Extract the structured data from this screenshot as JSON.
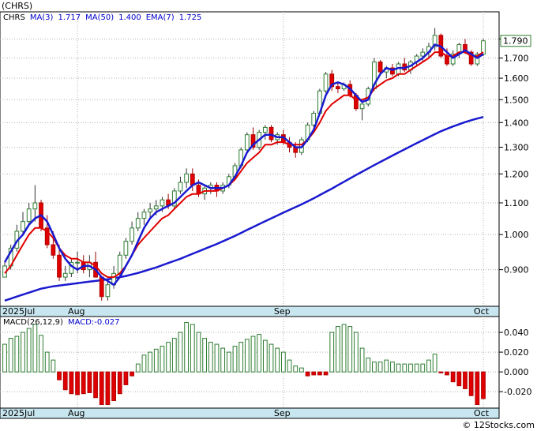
{
  "chart_data": [
    {
      "type": "candlestick",
      "title": "(CHRS)",
      "legend": [
        {
          "text": "CHRS",
          "color": "#000000"
        },
        {
          "text": "MA(3)",
          "color": "#0000cc"
        },
        {
          "text": "1.717",
          "color": "#0000cc"
        },
        {
          "text": "MA(50)",
          "color": "#0000cc"
        },
        {
          "text": "1.400",
          "color": "#0000cc"
        },
        {
          "text": "EMA(7)",
          "color": "#0000cc"
        },
        {
          "text": "1.725",
          "color": "#0000cc"
        }
      ],
      "y_scale": "log",
      "ylim": [
        0.81,
        1.93
      ],
      "y_ticks": [
        0.9,
        1.0,
        1.1,
        1.2,
        1.3,
        1.4,
        1.5,
        1.6,
        1.7,
        1.8
      ],
      "y_tick_labels": [
        "0.900",
        "1.000",
        "1.100",
        "1.200",
        "1.300",
        "1.400",
        "1.500",
        "1.600",
        "1.700",
        "1.800"
      ],
      "last_price_label": "1.790",
      "x_labels": [
        {
          "text": "2025Jul",
          "index": 0
        },
        {
          "text": "Aug",
          "index": 12
        },
        {
          "text": "Sep",
          "index": 46
        },
        {
          "text": "Oct",
          "index": 79
        }
      ],
      "grid": true,
      "ohlc": [
        [
          0.88,
          0.92,
          0.88,
          0.91
        ],
        [
          0.91,
          0.97,
          0.9,
          0.96
        ],
        [
          0.96,
          1.03,
          0.95,
          1.01
        ],
        [
          1.01,
          1.07,
          1.0,
          1.04
        ],
        [
          1.04,
          1.1,
          1.03,
          1.08
        ],
        [
          1.08,
          1.16,
          1.04,
          1.1
        ],
        [
          1.1,
          1.11,
          1.01,
          1.02
        ],
        [
          1.02,
          1.06,
          0.96,
          0.97
        ],
        [
          0.97,
          1.01,
          0.93,
          0.94
        ],
        [
          0.94,
          0.97,
          0.87,
          0.88
        ],
        [
          0.88,
          0.91,
          0.87,
          0.89
        ],
        [
          0.89,
          0.93,
          0.88,
          0.92
        ],
        [
          0.92,
          0.95,
          0.89,
          0.92
        ],
        [
          0.92,
          0.94,
          0.89,
          0.9
        ],
        [
          0.9,
          0.94,
          0.88,
          0.92
        ],
        [
          0.92,
          0.95,
          0.9,
          0.88
        ],
        [
          0.88,
          0.88,
          0.82,
          0.83
        ],
        [
          0.83,
          0.87,
          0.82,
          0.86
        ],
        [
          0.86,
          0.91,
          0.85,
          0.89
        ],
        [
          0.89,
          0.95,
          0.88,
          0.94
        ],
        [
          0.94,
          0.99,
          0.93,
          0.98
        ],
        [
          0.98,
          1.04,
          0.97,
          1.02
        ],
        [
          1.02,
          1.07,
          1.01,
          1.05
        ],
        [
          1.05,
          1.08,
          1.03,
          1.07
        ],
        [
          1.07,
          1.1,
          1.05,
          1.08
        ],
        [
          1.08,
          1.11,
          1.06,
          1.09
        ],
        [
          1.09,
          1.12,
          1.07,
          1.11
        ],
        [
          1.11,
          1.13,
          1.08,
          1.09
        ],
        [
          1.09,
          1.15,
          1.08,
          1.14
        ],
        [
          1.14,
          1.19,
          1.13,
          1.17
        ],
        [
          1.17,
          1.22,
          1.15,
          1.2
        ],
        [
          1.2,
          1.22,
          1.14,
          1.16
        ],
        [
          1.16,
          1.18,
          1.12,
          1.13
        ],
        [
          1.13,
          1.16,
          1.11,
          1.15
        ],
        [
          1.15,
          1.17,
          1.13,
          1.16
        ],
        [
          1.16,
          1.17,
          1.12,
          1.14
        ],
        [
          1.14,
          1.17,
          1.13,
          1.16
        ],
        [
          1.16,
          1.2,
          1.15,
          1.19
        ],
        [
          1.19,
          1.24,
          1.18,
          1.23
        ],
        [
          1.23,
          1.3,
          1.22,
          1.29
        ],
        [
          1.29,
          1.36,
          1.28,
          1.35
        ],
        [
          1.35,
          1.38,
          1.29,
          1.3
        ],
        [
          1.3,
          1.37,
          1.29,
          1.36
        ],
        [
          1.36,
          1.39,
          1.33,
          1.38
        ],
        [
          1.38,
          1.39,
          1.32,
          1.33
        ],
        [
          1.33,
          1.36,
          1.31,
          1.35
        ],
        [
          1.35,
          1.37,
          1.31,
          1.32
        ],
        [
          1.32,
          1.34,
          1.28,
          1.3
        ],
        [
          1.3,
          1.32,
          1.26,
          1.28
        ],
        [
          1.28,
          1.34,
          1.27,
          1.33
        ],
        [
          1.33,
          1.4,
          1.32,
          1.39
        ],
        [
          1.39,
          1.45,
          1.38,
          1.44
        ],
        [
          1.44,
          1.55,
          1.43,
          1.54
        ],
        [
          1.54,
          1.63,
          1.53,
          1.62
        ],
        [
          1.62,
          1.64,
          1.54,
          1.56
        ],
        [
          1.56,
          1.58,
          1.53,
          1.55
        ],
        [
          1.55,
          1.58,
          1.54,
          1.57
        ],
        [
          1.57,
          1.59,
          1.51,
          1.52
        ],
        [
          1.52,
          1.53,
          1.45,
          1.46
        ],
        [
          1.46,
          1.5,
          1.41,
          1.48
        ],
        [
          1.48,
          1.56,
          1.47,
          1.55
        ],
        [
          1.55,
          1.7,
          1.54,
          1.68
        ],
        [
          1.68,
          1.69,
          1.62,
          1.63
        ],
        [
          1.63,
          1.66,
          1.6,
          1.65
        ],
        [
          1.65,
          1.67,
          1.61,
          1.62
        ],
        [
          1.62,
          1.68,
          1.61,
          1.67
        ],
        [
          1.67,
          1.7,
          1.63,
          1.64
        ],
        [
          1.64,
          1.69,
          1.62,
          1.68
        ],
        [
          1.68,
          1.72,
          1.66,
          1.71
        ],
        [
          1.71,
          1.75,
          1.68,
          1.73
        ],
        [
          1.73,
          1.78,
          1.7,
          1.76
        ],
        [
          1.76,
          1.86,
          1.74,
          1.82
        ],
        [
          1.82,
          1.83,
          1.7,
          1.71
        ],
        [
          1.71,
          1.75,
          1.66,
          1.67
        ],
        [
          1.67,
          1.74,
          1.66,
          1.72
        ],
        [
          1.72,
          1.78,
          1.7,
          1.77
        ],
        [
          1.77,
          1.8,
          1.72,
          1.73
        ],
        [
          1.73,
          1.74,
          1.66,
          1.67
        ],
        [
          1.67,
          1.73,
          1.66,
          1.72
        ],
        [
          1.72,
          1.8,
          1.71,
          1.79
        ]
      ],
      "ma3": [
        0.92,
        0.95,
        0.98,
        1.0,
        1.03,
        1.05,
        1.06,
        1.04,
        1.0,
        0.96,
        0.93,
        0.91,
        0.9,
        0.91,
        0.91,
        0.9,
        0.88,
        0.87,
        0.86,
        0.88,
        0.91,
        0.94,
        0.98,
        1.02,
        1.05,
        1.07,
        1.08,
        1.09,
        1.1,
        1.12,
        1.14,
        1.16,
        1.17,
        1.16,
        1.15,
        1.15,
        1.15,
        1.16,
        1.19,
        1.23,
        1.28,
        1.31,
        1.33,
        1.35,
        1.35,
        1.34,
        1.34,
        1.32,
        1.3,
        1.3,
        1.33,
        1.37,
        1.44,
        1.52,
        1.57,
        1.58,
        1.57,
        1.55,
        1.52,
        1.49,
        1.5,
        1.57,
        1.62,
        1.65,
        1.64,
        1.65,
        1.65,
        1.66,
        1.68,
        1.7,
        1.73,
        1.77,
        1.76,
        1.73,
        1.7,
        1.72,
        1.74,
        1.72,
        1.7,
        1.72
      ],
      "ma50": [
        0.82,
        0.825,
        0.83,
        0.835,
        0.84,
        0.845,
        0.85,
        0.853,
        0.856,
        0.858,
        0.86,
        0.862,
        0.864,
        0.866,
        0.868,
        0.87,
        0.872,
        0.874,
        0.877,
        0.88,
        0.883,
        0.887,
        0.891,
        0.896,
        0.901,
        0.906,
        0.912,
        0.918,
        0.924,
        0.93,
        0.937,
        0.944,
        0.951,
        0.958,
        0.965,
        0.972,
        0.98,
        0.988,
        0.996,
        1.005,
        1.014,
        1.023,
        1.032,
        1.041,
        1.05,
        1.059,
        1.068,
        1.077,
        1.086,
        1.095,
        1.105,
        1.115,
        1.126,
        1.137,
        1.148,
        1.16,
        1.172,
        1.184,
        1.196,
        1.208,
        1.22,
        1.232,
        1.244,
        1.256,
        1.268,
        1.28,
        1.292,
        1.304,
        1.316,
        1.328,
        1.34,
        1.352,
        1.364,
        1.374,
        1.384,
        1.393,
        1.402,
        1.41,
        1.417,
        1.424
      ],
      "ema7": [
        0.89,
        0.91,
        0.94,
        0.97,
        1.0,
        1.02,
        1.02,
        1.01,
        0.99,
        0.96,
        0.94,
        0.93,
        0.93,
        0.92,
        0.92,
        0.91,
        0.89,
        0.88,
        0.88,
        0.89,
        0.91,
        0.94,
        0.97,
        0.99,
        1.01,
        1.03,
        1.05,
        1.06,
        1.08,
        1.1,
        1.12,
        1.13,
        1.13,
        1.14,
        1.14,
        1.14,
        1.15,
        1.16,
        1.18,
        1.21,
        1.24,
        1.26,
        1.28,
        1.31,
        1.31,
        1.32,
        1.32,
        1.31,
        1.31,
        1.31,
        1.33,
        1.36,
        1.4,
        1.45,
        1.48,
        1.5,
        1.52,
        1.52,
        1.5,
        1.5,
        1.51,
        1.55,
        1.57,
        1.59,
        1.6,
        1.62,
        1.62,
        1.64,
        1.66,
        1.68,
        1.7,
        1.73,
        1.73,
        1.71,
        1.71,
        1.73,
        1.73,
        1.71,
        1.71,
        1.73
      ]
    },
    {
      "type": "bar",
      "title": "MACD(26,12,9)",
      "legend": [
        {
          "text": "MACD(26,12,9)",
          "color": "#000000"
        },
        {
          "text": "MACD:-0.027",
          "color": "#0000cc"
        }
      ],
      "ylim": [
        -0.035,
        0.052
      ],
      "y_ticks": [
        -0.02,
        0.0,
        0.02,
        0.04
      ],
      "y_tick_labels": [
        "-0.020",
        "0.000",
        "0.020",
        "0.040"
      ],
      "x_labels": [
        {
          "text": "2025Jul",
          "index": 0
        },
        {
          "text": "Aug",
          "index": 12
        },
        {
          "text": "Sep",
          "index": 46
        },
        {
          "text": "Oct",
          "index": 79
        }
      ],
      "grid": true,
      "values": [
        0.028,
        0.034,
        0.036,
        0.04,
        0.044,
        0.048,
        0.037,
        0.02,
        0.012,
        -0.008,
        -0.018,
        -0.022,
        -0.023,
        -0.022,
        -0.021,
        -0.026,
        -0.033,
        -0.033,
        -0.029,
        -0.022,
        -0.013,
        -0.004,
        0.008,
        0.017,
        0.02,
        0.023,
        0.026,
        0.03,
        0.034,
        0.04,
        0.05,
        0.048,
        0.04,
        0.034,
        0.03,
        0.028,
        0.024,
        0.02,
        0.026,
        0.03,
        0.033,
        0.036,
        0.038,
        0.032,
        0.028,
        0.024,
        0.02,
        0.012,
        0.006,
        0.004,
        -0.004,
        -0.003,
        -0.003,
        -0.003,
        0.04,
        0.046,
        0.048,
        0.046,
        0.04,
        0.024,
        0.014,
        0.01,
        0.01,
        0.012,
        0.01,
        0.008,
        0.008,
        0.008,
        0.008,
        0.008,
        0.012,
        0.018,
        -0.001,
        -0.003,
        -0.01,
        -0.014,
        -0.017,
        -0.024,
        -0.033,
        -0.027
      ]
    }
  ],
  "watermark": "© 12Stocks.com"
}
